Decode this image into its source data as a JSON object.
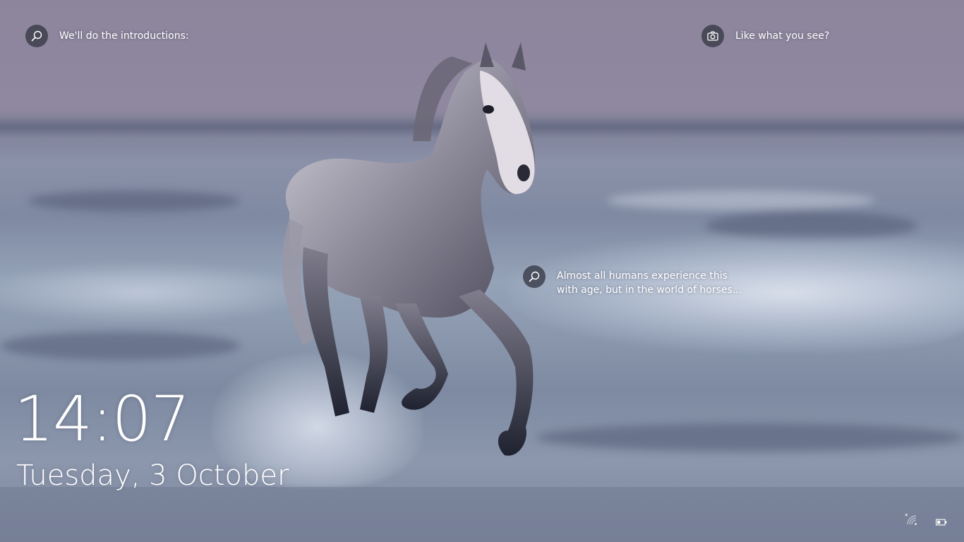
{
  "spotlight": {
    "intro_text": "We'll do the introductions:",
    "intro_icon": "search-icon",
    "like_text": "Like what you see?",
    "like_icon": "camera-icon",
    "fact_text": "Almost all humans experience this with age, but in the world of horses...",
    "fact_icon": "search-icon"
  },
  "clock": {
    "time": "14:07",
    "date": "Tuesday, 3 October"
  },
  "tray": {
    "network_icon": "wifi-disconnected-icon",
    "battery_icon": "battery-icon"
  },
  "colors": {
    "sky": "#8d859c",
    "sea": "#8a97ad",
    "icon_bg": "#32344a",
    "text": "#ffffff"
  }
}
